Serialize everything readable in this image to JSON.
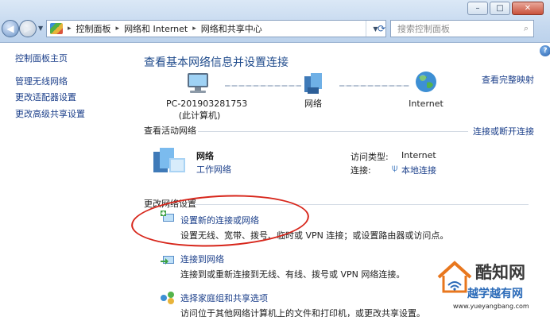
{
  "window": {
    "controls": [
      "–",
      "□",
      "✕"
    ]
  },
  "address_bar": {
    "breadcrumbs": [
      "控制面板",
      "网络和 Internet",
      "网络和共享中心"
    ],
    "search_placeholder": "搜索控制面板"
  },
  "sidebar": {
    "items": [
      {
        "label": "控制面板主页"
      },
      {
        "label": "管理无线网络"
      },
      {
        "label": "更改适配器设置"
      },
      {
        "label": "更改高级共享设置"
      }
    ]
  },
  "main": {
    "title": "查看基本网络信息并设置连接",
    "full_map_link": "查看完整映射",
    "map": {
      "computer_name": "PC-201903281753",
      "computer_sub": "(此计算机)",
      "network_label": "网络",
      "internet_label": "Internet"
    },
    "active": {
      "header": "查看活动网络",
      "connect_link": "连接或断开连接",
      "network_name": "网络",
      "network_type": "工作网络",
      "access_type_label": "访问类型:",
      "access_type_value": "Internet",
      "connection_label": "连接:",
      "connection_value": "本地连接"
    },
    "settings": {
      "header": "更改网络设置",
      "tasks": [
        {
          "link": "设置新的连接或网络",
          "desc": "设置无线、宽带、拨号、临时或 VPN 连接；或设置路由器或访问点。"
        },
        {
          "link": "连接到网络",
          "desc": "连接到或重新连接到无线、有线、拨号或 VPN 网络连接。"
        },
        {
          "link": "选择家庭组和共享选项",
          "desc": "访问位于其他网络计算机上的文件和打印机，或更改共享设置。"
        }
      ]
    }
  },
  "watermark": {
    "title": "酷知网",
    "subtitle": "越学越有网",
    "url": "www.yueyangbang.com"
  },
  "colors": {
    "link": "#1b3f8a",
    "title": "#1e4a8b",
    "annotation": "#d7261b"
  }
}
